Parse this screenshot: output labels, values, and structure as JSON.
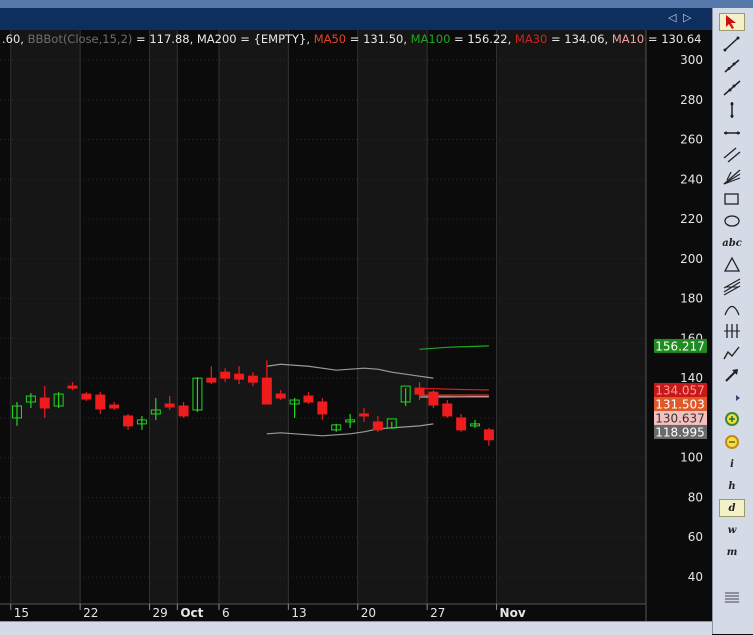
{
  "indicator_line": [
    {
      "text": ".60, ",
      "color": "#e8e8e8"
    },
    {
      "text": "BBBot(Close,15,2)",
      "color": "#6e6e6e"
    },
    {
      "text": " = 117.88, MA200 = {EMPTY}, ",
      "color": "#e8e8e8"
    },
    {
      "text": "MA50",
      "color": "#e0442a"
    },
    {
      "text": " = 131.50, ",
      "color": "#e8e8e8"
    },
    {
      "text": "MA100",
      "color": "#1ea81e"
    },
    {
      "text": " = 156.22, ",
      "color": "#e8e8e8"
    },
    {
      "text": "MA30",
      "color": "#d42020"
    },
    {
      "text": " = 134.06, ",
      "color": "#e8e8e8"
    },
    {
      "text": "MA10",
      "color": "#f2a0a0"
    },
    {
      "text": " = 130.64",
      "color": "#e8e8e8"
    }
  ],
  "nav": {
    "prev": "◁",
    "next": "▷"
  },
  "chart_data": {
    "type": "candlestick",
    "y_axis": {
      "ticks": [
        40,
        60,
        80,
        100,
        120,
        140,
        160,
        180,
        200,
        220,
        240,
        260,
        280,
        300
      ],
      "range": [
        28,
        316
      ],
      "side": "right"
    },
    "x_axis": {
      "ticks": [
        {
          "label": "15",
          "index": 0
        },
        {
          "label": "22",
          "index": 5
        },
        {
          "label": "29",
          "index": 10
        },
        {
          "label": "Oct",
          "index": 12,
          "bold": true
        },
        {
          "label": "6",
          "index": 15
        },
        {
          "label": "13",
          "index": 20
        },
        {
          "label": "20",
          "index": 25
        },
        {
          "label": "27",
          "index": 30
        },
        {
          "label": "Nov",
          "index": 35,
          "bold": true
        }
      ]
    },
    "candles": [
      {
        "o": 120.0,
        "h": 128.0,
        "l": 116.0,
        "c": 126.0
      },
      {
        "o": 128.0,
        "h": 132.5,
        "l": 125.0,
        "c": 131.0
      },
      {
        "o": 130.0,
        "h": 136.0,
        "l": 120.0,
        "c": 125.0
      },
      {
        "o": 126.0,
        "h": 133.0,
        "l": 125.0,
        "c": 132.0
      },
      {
        "o": 136.0,
        "h": 138.0,
        "l": 134.0,
        "c": 135.0
      },
      {
        "o": 132.0,
        "h": 133.0,
        "l": 128.5,
        "c": 129.5
      },
      {
        "o": 131.5,
        "h": 133.0,
        "l": 122.0,
        "c": 124.5
      },
      {
        "o": 126.5,
        "h": 128.0,
        "l": 124.0,
        "c": 125.0
      },
      {
        "o": 121.0,
        "h": 122.0,
        "l": 114.0,
        "c": 116.0
      },
      {
        "o": 117.0,
        "h": 121.0,
        "l": 114.0,
        "c": 119.0
      },
      {
        "o": 122.0,
        "h": 130.0,
        "l": 119.0,
        "c": 124.0
      },
      {
        "o": 127.0,
        "h": 131.0,
        "l": 124.0,
        "c": 125.5
      },
      {
        "o": 126.0,
        "h": 128.0,
        "l": 120.0,
        "c": 121.0
      },
      {
        "o": 124.0,
        "h": 140.5,
        "l": 123.0,
        "c": 140.0
      },
      {
        "o": 140.0,
        "h": 146.0,
        "l": 137.0,
        "c": 138.0
      },
      {
        "o": 143.0,
        "h": 145.0,
        "l": 138.0,
        "c": 140.0
      },
      {
        "o": 142.0,
        "h": 146.0,
        "l": 137.0,
        "c": 139.5
      },
      {
        "o": 141.0,
        "h": 143.0,
        "l": 136.0,
        "c": 138.0
      },
      {
        "o": 140.0,
        "h": 149.0,
        "l": 132.0,
        "c": 127.0
      },
      {
        "o": 132.0,
        "h": 134.0,
        "l": 129.0,
        "c": 130.0
      },
      {
        "o": 127.0,
        "h": 130.0,
        "l": 120.0,
        "c": 129.0
      },
      {
        "o": 131.0,
        "h": 133.0,
        "l": 127.0,
        "c": 128.0
      },
      {
        "o": 128.0,
        "h": 130.0,
        "l": 119.0,
        "c": 122.0
      },
      {
        "o": 114.0,
        "h": 117.0,
        "l": 113.0,
        "c": 116.5
      },
      {
        "o": 118.0,
        "h": 122.0,
        "l": 115.0,
        "c": 119.0
      },
      {
        "o": 122.0,
        "h": 125.0,
        "l": 118.0,
        "c": 121.0
      },
      {
        "o": 118.0,
        "h": 121.0,
        "l": 113.0,
        "c": 114.0
      },
      {
        "o": 115.0,
        "h": 118.0,
        "l": 114.5,
        "c": 119.5
      },
      {
        "o": 128.0,
        "h": 135.0,
        "l": 126.0,
        "c": 136.0
      },
      {
        "o": 135.0,
        "h": 138.0,
        "l": 129.0,
        "c": 132.0
      },
      {
        "o": 133.0,
        "h": 134.0,
        "l": 125.0,
        "c": 126.5
      },
      {
        "o": 127.0,
        "h": 129.0,
        "l": 120.0,
        "c": 121.0
      },
      {
        "o": 120.0,
        "h": 122.0,
        "l": 113.0,
        "c": 114.0
      },
      {
        "o": 116.0,
        "h": 119.0,
        "l": 115.0,
        "c": 117.0
      },
      {
        "o": 114.0,
        "h": 115.0,
        "l": 106.0,
        "c": 109.0
      }
    ],
    "series": [
      {
        "name": "BBTop",
        "color": "#9a9a9a",
        "values": [
          null,
          null,
          null,
          null,
          null,
          null,
          null,
          null,
          null,
          null,
          null,
          null,
          null,
          null,
          null,
          null,
          null,
          null,
          146.0,
          147.0,
          146.5,
          146.0,
          145.0,
          144.0,
          144.5,
          145.0,
          144.5,
          143.0,
          142.0,
          141.0,
          140.0,
          null,
          null,
          null,
          null
        ]
      },
      {
        "name": "BBBot",
        "color": "#9a9a9a",
        "values": [
          null,
          null,
          null,
          null,
          null,
          null,
          null,
          null,
          null,
          null,
          null,
          null,
          null,
          null,
          null,
          null,
          null,
          null,
          112.0,
          112.5,
          112.0,
          111.5,
          111.0,
          111.5,
          112.0,
          113.0,
          114.5,
          115.0,
          115.5,
          116.0,
          117.0,
          null,
          null,
          null,
          null
        ]
      },
      {
        "name": "MA100",
        "color": "#1ea81e",
        "values": [
          null,
          null,
          null,
          null,
          null,
          null,
          null,
          null,
          null,
          null,
          null,
          null,
          null,
          null,
          null,
          null,
          null,
          null,
          null,
          null,
          null,
          null,
          null,
          null,
          null,
          null,
          null,
          null,
          null,
          154.5,
          155.0,
          155.5,
          155.8,
          156.0,
          156.22
        ]
      },
      {
        "name": "MA50",
        "color": "#e0442a",
        "values": [
          null,
          null,
          null,
          null,
          null,
          null,
          null,
          null,
          null,
          null,
          null,
          null,
          null,
          null,
          null,
          null,
          null,
          null,
          null,
          null,
          null,
          null,
          null,
          null,
          null,
          null,
          null,
          null,
          null,
          131.4,
          131.4,
          131.45,
          131.5,
          131.5,
          131.5
        ]
      },
      {
        "name": "MA30",
        "color": "#d42020",
        "values": [
          null,
          null,
          null,
          null,
          null,
          null,
          null,
          null,
          null,
          null,
          null,
          null,
          null,
          null,
          null,
          null,
          null,
          null,
          null,
          null,
          null,
          null,
          null,
          null,
          null,
          null,
          null,
          null,
          null,
          134.8,
          134.7,
          134.5,
          134.3,
          134.2,
          134.06
        ]
      },
      {
        "name": "MA10",
        "color": "#f2a0a0",
        "values": [
          null,
          null,
          null,
          null,
          null,
          null,
          null,
          null,
          null,
          null,
          null,
          null,
          null,
          null,
          null,
          null,
          null,
          null,
          null,
          null,
          null,
          null,
          null,
          null,
          null,
          null,
          null,
          null,
          null,
          130.5,
          130.6,
          130.6,
          130.62,
          130.63,
          130.64
        ]
      }
    ],
    "price_labels": [
      {
        "value": 156.217,
        "text": "156.217",
        "bg": "#1f8c1f",
        "fg": "#ffffff"
      },
      {
        "value": 134.057,
        "text": "134.057",
        "bg": "#c81818",
        "fg": "#ff9a9a"
      },
      {
        "value": 131.503,
        "text": "131.503",
        "bg": "#e05a28",
        "fg": "#ffffff"
      },
      {
        "value": 130.637,
        "text": "130.637",
        "bg": "#f6c0c0",
        "fg": "#333333"
      },
      {
        "value": 118.995,
        "text": "118.995",
        "bg": "#6a6a6a",
        "fg": "#ffffff"
      }
    ],
    "colors": {
      "up": "#22d622",
      "down": "#ee1c1c",
      "grid": "#2a2a2a",
      "axis_text": "#e6e6e6"
    }
  },
  "tools": [
    {
      "icon": "pointer-icon",
      "active": true
    },
    {
      "icon": "line-segment-icon"
    },
    {
      "icon": "ray-icon"
    },
    {
      "icon": "extended-line-icon"
    },
    {
      "icon": "vertical-line-icon"
    },
    {
      "icon": "horizontal-line-icon"
    },
    {
      "icon": "parallel-lines-icon"
    },
    {
      "icon": "fan-lines-icon"
    },
    {
      "icon": "rectangle-icon"
    },
    {
      "icon": "ellipse-icon"
    },
    {
      "icon": "text-icon",
      "text": "abc"
    },
    {
      "icon": "triangle-icon"
    },
    {
      "icon": "fibonacci-icon"
    },
    {
      "icon": "arc-icon"
    },
    {
      "icon": "cycle-lines-icon"
    },
    {
      "icon": "polyline-icon"
    },
    {
      "icon": "magnet-arrow-icon"
    },
    {
      "icon": "toolbar-scroll-icon"
    },
    {
      "icon": "zoom-in-icon"
    },
    {
      "icon": "zoom-out-icon"
    },
    {
      "icon": "interval-i-icon",
      "text": "i"
    },
    {
      "icon": "interval-h-icon",
      "text": "h"
    },
    {
      "icon": "interval-d-icon",
      "text": "d",
      "active": true
    },
    {
      "icon": "interval-w-icon",
      "text": "w"
    },
    {
      "icon": "interval-m-icon",
      "text": "m"
    },
    {
      "icon": "grip-icon"
    }
  ]
}
